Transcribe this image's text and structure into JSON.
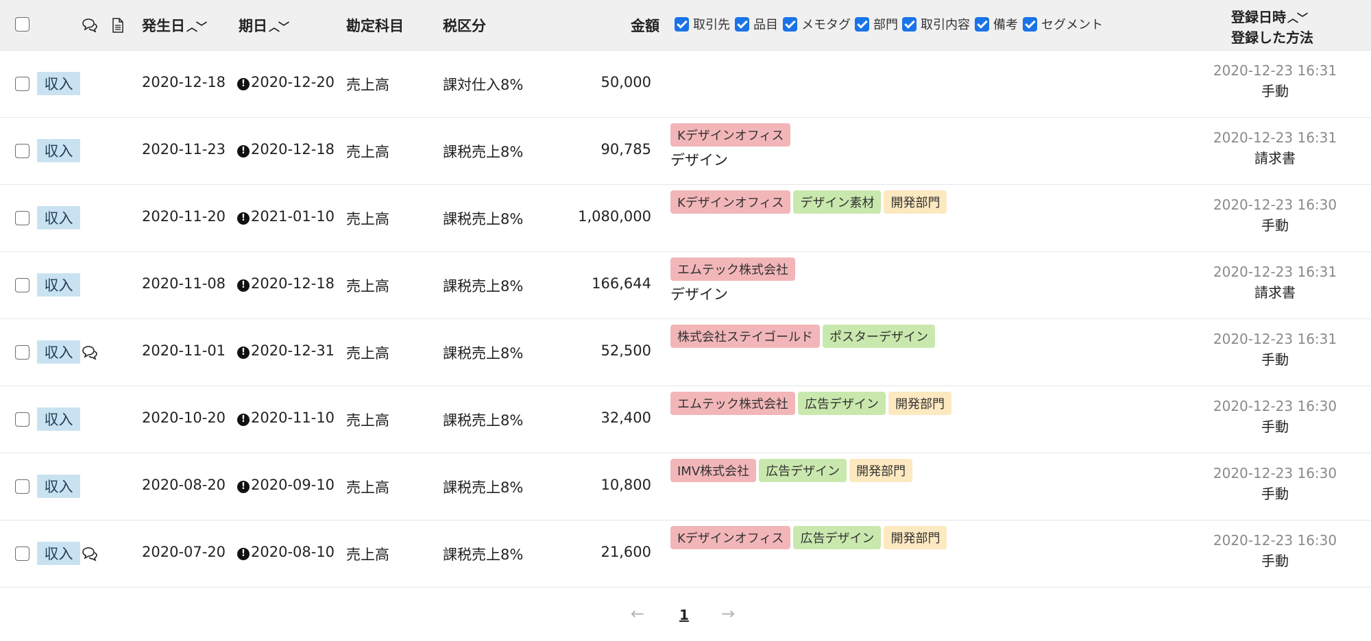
{
  "header": {
    "occurred_label": "発生日",
    "due_label": "期日",
    "account_label": "勘定科目",
    "tax_label": "税区分",
    "amount_label": "金額",
    "registered_label": "登録日時",
    "method_label": "登録した方法",
    "toggles": [
      "取引先",
      "品目",
      "メモタグ",
      "部門",
      "取引内容",
      "備考",
      "セグメント"
    ]
  },
  "rows": [
    {
      "type": "収入",
      "comment": false,
      "occurred": "2020-12-18",
      "due": "2020-12-20",
      "account": "売上高",
      "tax": "課対仕入8%",
      "amount": "50,000",
      "tags": [],
      "memo": "",
      "registered": "2020-12-23 16:31",
      "method": "手動"
    },
    {
      "type": "収入",
      "comment": false,
      "occurred": "2020-11-23",
      "due": "2020-12-18",
      "account": "売上高",
      "tax": "課税売上8%",
      "amount": "90,785",
      "tags": [
        {
          "label": "Kデザインオフィス",
          "kind": "partner"
        }
      ],
      "memo": "デザイン",
      "registered": "2020-12-23 16:31",
      "method": "請求書"
    },
    {
      "type": "収入",
      "comment": false,
      "occurred": "2020-11-20",
      "due": "2021-01-10",
      "account": "売上高",
      "tax": "課税売上8%",
      "amount": "1,080,000",
      "tags": [
        {
          "label": "Kデザインオフィス",
          "kind": "partner"
        },
        {
          "label": "デザイン素材",
          "kind": "item"
        },
        {
          "label": "開発部門",
          "kind": "dept"
        }
      ],
      "memo": "",
      "registered": "2020-12-23 16:30",
      "method": "手動"
    },
    {
      "type": "収入",
      "comment": false,
      "occurred": "2020-11-08",
      "due": "2020-12-18",
      "account": "売上高",
      "tax": "課税売上8%",
      "amount": "166,644",
      "tags": [
        {
          "label": "エムテック株式会社",
          "kind": "partner"
        }
      ],
      "memo": "デザイン",
      "registered": "2020-12-23 16:31",
      "method": "請求書"
    },
    {
      "type": "収入",
      "comment": true,
      "occurred": "2020-11-01",
      "due": "2020-12-31",
      "account": "売上高",
      "tax": "課税売上8%",
      "amount": "52,500",
      "tags": [
        {
          "label": "株式会社ステイゴールド",
          "kind": "partner"
        },
        {
          "label": "ポスターデザイン",
          "kind": "item"
        }
      ],
      "memo": "",
      "registered": "2020-12-23 16:31",
      "method": "手動"
    },
    {
      "type": "収入",
      "comment": false,
      "occurred": "2020-10-20",
      "due": "2020-11-10",
      "account": "売上高",
      "tax": "課税売上8%",
      "amount": "32,400",
      "tags": [
        {
          "label": "エムテック株式会社",
          "kind": "partner"
        },
        {
          "label": "広告デザイン",
          "kind": "item"
        },
        {
          "label": "開発部門",
          "kind": "dept"
        }
      ],
      "memo": "",
      "registered": "2020-12-23 16:30",
      "method": "手動"
    },
    {
      "type": "収入",
      "comment": false,
      "occurred": "2020-08-20",
      "due": "2020-09-10",
      "account": "売上高",
      "tax": "課税売上8%",
      "amount": "10,800",
      "tags": [
        {
          "label": "IMV株式会社",
          "kind": "partner"
        },
        {
          "label": "広告デザイン",
          "kind": "item"
        },
        {
          "label": "開発部門",
          "kind": "dept"
        }
      ],
      "memo": "",
      "registered": "2020-12-23 16:30",
      "method": "手動"
    },
    {
      "type": "収入",
      "comment": true,
      "occurred": "2020-07-20",
      "due": "2020-08-10",
      "account": "売上高",
      "tax": "課税売上8%",
      "amount": "21,600",
      "tags": [
        {
          "label": "Kデザインオフィス",
          "kind": "partner"
        },
        {
          "label": "広告デザイン",
          "kind": "item"
        },
        {
          "label": "開発部門",
          "kind": "dept"
        }
      ],
      "memo": "",
      "registered": "2020-12-23 16:30",
      "method": "手動"
    }
  ],
  "pager": {
    "prev": "←",
    "current": "1",
    "next": "→"
  },
  "colors": {
    "badge": "#c9e2f1",
    "partner": "#f2b6b9",
    "item": "#c9e8ad",
    "dept": "#fde9c0"
  }
}
